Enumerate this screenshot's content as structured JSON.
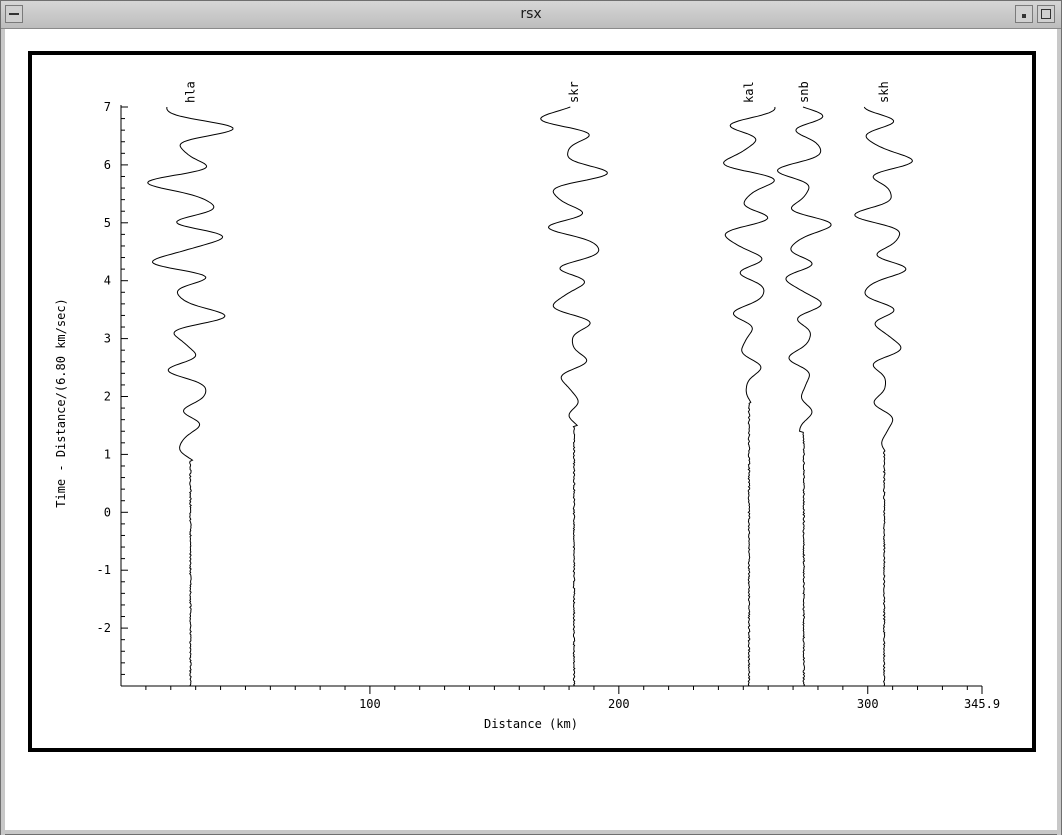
{
  "window": {
    "title": "rsx"
  },
  "chart_data": {
    "type": "line",
    "xlabel": "Distance (km)",
    "ylabel": "Time - Distance/(6.80 km/sec)",
    "xlim": [
      0,
      345.9
    ],
    "ylim": [
      -3,
      7
    ],
    "x_ticks": [
      "100",
      "200",
      "300",
      "345.9"
    ],
    "y_ticks": [
      "-2",
      "-1",
      "0",
      "1",
      "2",
      "3",
      "4",
      "5",
      "6",
      "7"
    ],
    "grid": false,
    "series": [
      {
        "name": "hla",
        "station_distance": 27.9,
        "onset_time": 0.9,
        "amplitude_km": 25
      },
      {
        "name": "skr",
        "station_distance": 182.0,
        "onset_time": 1.5,
        "amplitude_km": 20
      },
      {
        "name": "kal",
        "station_distance": 252.3,
        "onset_time": 1.9,
        "amplitude_km": 18
      },
      {
        "name": "snb",
        "station_distance": 274.3,
        "onset_time": 1.4,
        "amplitude_km": 16
      },
      {
        "name": "skh",
        "station_distance": 306.6,
        "onset_time": 1.1,
        "amplitude_km": 17
      }
    ]
  }
}
